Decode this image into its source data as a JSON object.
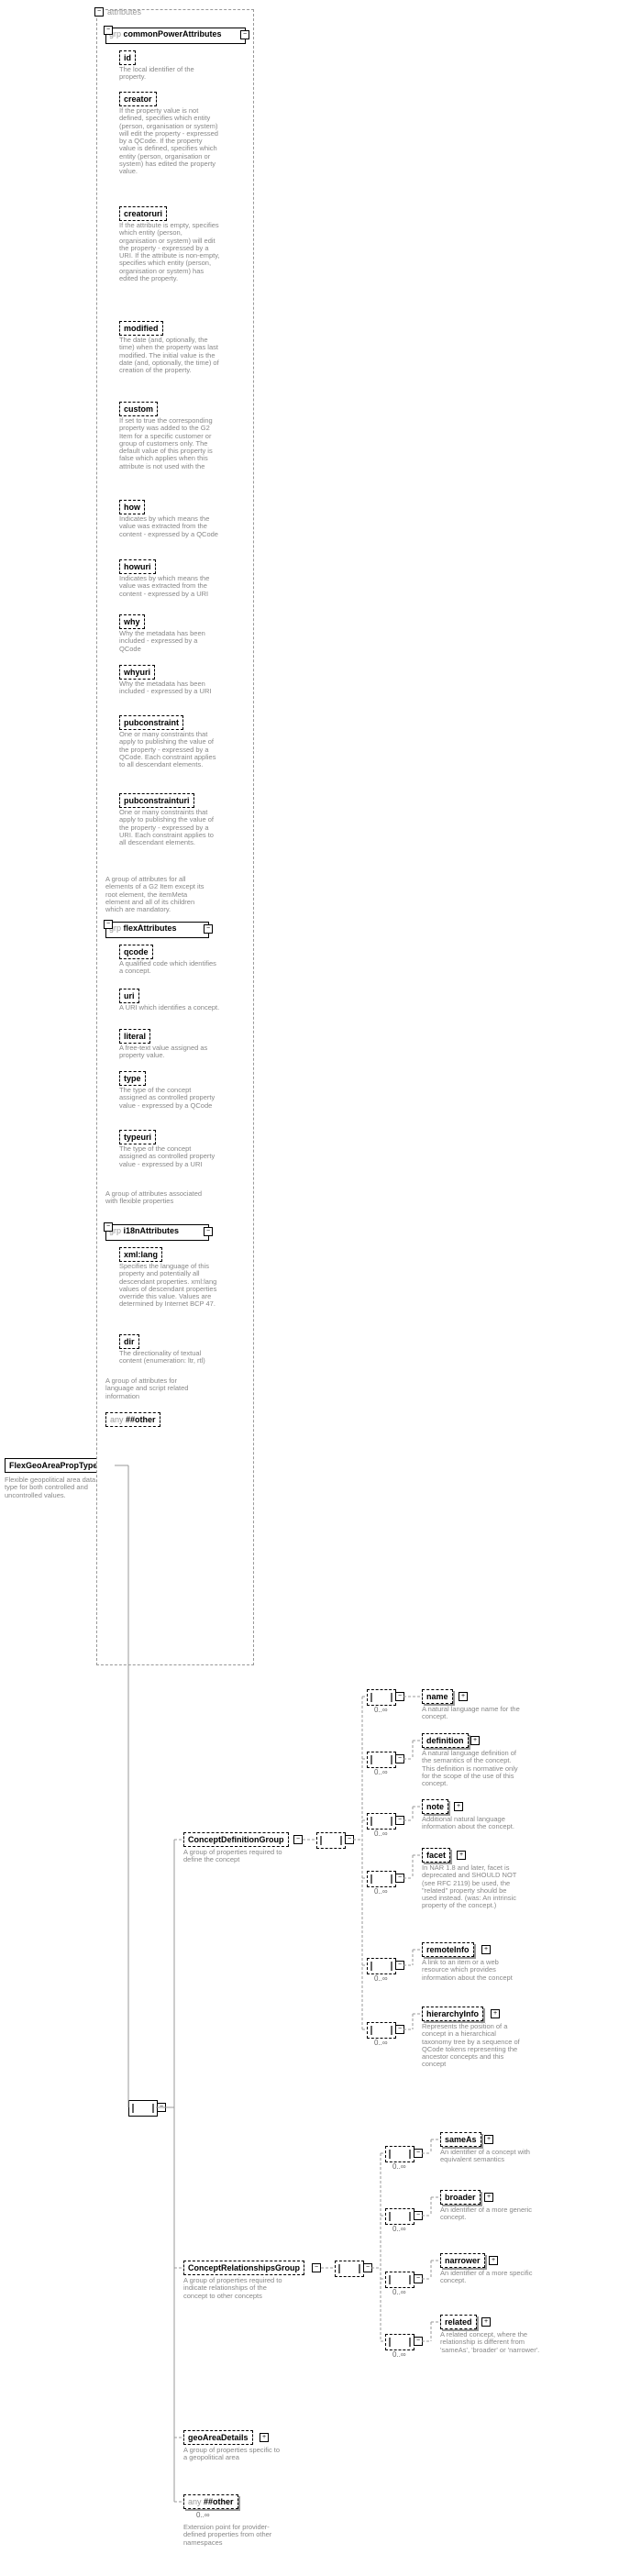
{
  "root": {
    "name": "FlexGeoAreaPropType",
    "desc": "Flexible geopolitical area data type for both controlled and uncontrolled values."
  },
  "attributes_label": "attributes",
  "grp1": {
    "title": "commonPowerAttributes",
    "prefix": "grp",
    "desc": "A group of attributes for all elements of a G2 Item except its root element, the itemMeta element and all of its children which are mandatory.",
    "items": [
      {
        "name": "id",
        "desc": "The local identifier of the property."
      },
      {
        "name": "creator",
        "desc": "If the property value is not defined, specifies which entity (person, organisation or system) will edit the property - expressed by a QCode. If the property value is defined, specifies which entity (person, organisation or system) has edited the property value."
      },
      {
        "name": "creatoruri",
        "desc": "If the attribute is empty, specifies which entity (person, organisation or system) will edit the property - expressed by a URI. If the attribute is non-empty, specifies which entity (person, organisation or system) has edited the property."
      },
      {
        "name": "modified",
        "desc": "The date (and, optionally, the time) when the property was last modified. The initial value is the date (and, optionally, the time) of creation of the property."
      },
      {
        "name": "custom",
        "desc": "If set to true the corresponding property was added to the G2 Item for a specific customer or group of customers only. The default value of this property is false which applies when this attribute is not used with the"
      },
      {
        "name": "how",
        "desc": "Indicates by which means the value was extracted from the content - expressed by a QCode"
      },
      {
        "name": "howuri",
        "desc": "Indicates by which means the value was extracted from the content - expressed by a URI"
      },
      {
        "name": "why",
        "desc": "Why the metadata has been included - expressed by a QCode"
      },
      {
        "name": "whyuri",
        "desc": "Why the metadata has been included - expressed by a URI"
      },
      {
        "name": "pubconstraint",
        "desc": "One or many constraints that apply to publishing the value of the property - expressed by a QCode. Each constraint applies to all descendant elements."
      },
      {
        "name": "pubconstrainturi",
        "desc": "One or many constraints that apply to publishing the value of the property - expressed by a URI. Each constraint applies to all descendant elements."
      }
    ]
  },
  "grp2": {
    "title": "flexAttributes",
    "prefix": "grp",
    "desc": "A group of attributes associated with flexible properties",
    "items": [
      {
        "name": "qcode",
        "desc": "A qualified code which identifies a concept."
      },
      {
        "name": "uri",
        "desc": "A URI which identifies a concept."
      },
      {
        "name": "literal",
        "desc": "A free-text value assigned as property value."
      },
      {
        "name": "type",
        "desc": "The type of the concept assigned as controlled property value - expressed by a QCode"
      },
      {
        "name": "typeuri",
        "desc": "The type of the concept assigned as controlled property value - expressed by a URI"
      }
    ]
  },
  "grp3": {
    "title": "i18nAttributes",
    "prefix": "grp",
    "desc": "A group of attributes for language and script related information",
    "items": [
      {
        "name": "xml:lang",
        "desc": "Specifies the language of this property and potentially all descendant properties. xml:lang values of descendant properties override this value. Values are determined by Internet BCP 47."
      },
      {
        "name": "dir",
        "desc": "The directionality of textual content (enumeration: ltr, rtl)"
      }
    ]
  },
  "any_other": "##other",
  "any_label": "any",
  "cdg": {
    "name": "ConceptDefinitionGroup",
    "desc": "A group of properties required to define the concept",
    "items": [
      {
        "name": "name",
        "desc": "A natural language name for the concept."
      },
      {
        "name": "definition",
        "desc": "A natural language definition of the semantics of the concept. This definition is normative only for the scope of the use of this concept."
      },
      {
        "name": "note",
        "desc": "Additional natural language information about the concept."
      },
      {
        "name": "facet",
        "desc": "In NAR 1.8 and later, facet is deprecated and SHOULD NOT (see RFC 2119) be used, the \"related\" property should be used instead. (was: An intrinsic property of the concept.)"
      },
      {
        "name": "remoteInfo",
        "desc": "A link to an item or a web resource which provides information about the concept"
      },
      {
        "name": "hierarchyInfo",
        "desc": "Represents the position of a concept in a hierarchical taxonomy tree by a sequence of QCode tokens representing the ancestor concepts and this concept"
      }
    ]
  },
  "crg": {
    "name": "ConceptRelationshipsGroup",
    "desc": "A group of properties required to indicate relationships of the concept to other concepts",
    "items": [
      {
        "name": "sameAs",
        "desc": "An identifier of a concept with equivalent semantics"
      },
      {
        "name": "broader",
        "desc": "An identifier of a more generic concept."
      },
      {
        "name": "narrower",
        "desc": "An identifier of a more specific concept."
      },
      {
        "name": "related",
        "desc": "A related concept, where the relationship is different from 'sameAs', 'broader' or 'narrower'."
      }
    ]
  },
  "geo": {
    "name": "geoAreaDetails",
    "desc": "A group of properties specific to a geopolitical area"
  },
  "ext": {
    "name": "##other",
    "desc": "Extension point for provider-defined properties from other namespaces"
  },
  "occ_inf": "0..∞",
  "chart_data": {
    "type": "diagram",
    "note": "XSD schema visualization tree"
  }
}
